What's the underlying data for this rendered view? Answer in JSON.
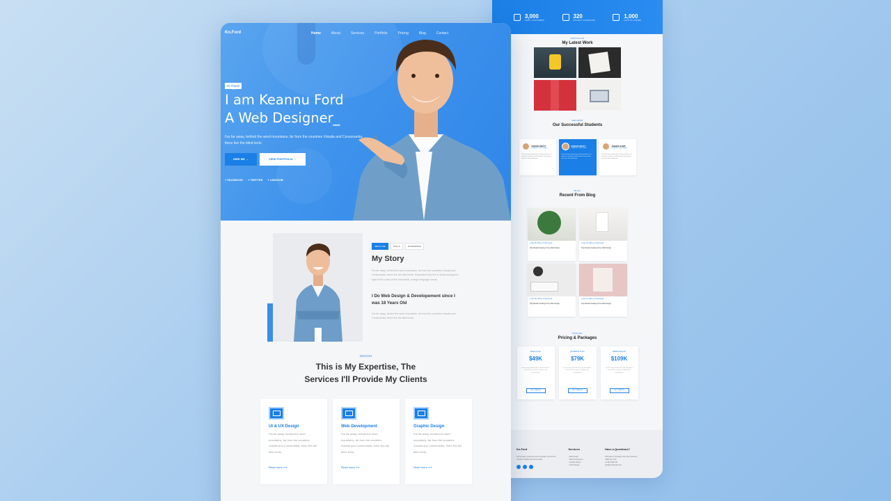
{
  "back_page": {
    "stats": [
      {
        "value": "3,000",
        "label": "HAPPY CUSTOMERS"
      },
      {
        "value": "320",
        "label": "PROJECT COMPLETED"
      },
      {
        "value": "1,000",
        "label": "CUPS OF COFFEE"
      }
    ],
    "work": {
      "kicker": "PORTFOLIO",
      "title": "My Latest Work"
    },
    "students": {
      "kicker": "REVIEWS",
      "title": "Our Successful Students",
      "items": [
        {
          "name": "ROGER WOTT",
          "role": "GRAPHIC DESIGNER",
          "text": "Far far away, behind the word mountains, far from the countries Vokalia and Consonantia, there live the blind texts."
        },
        {
          "name": "ROGER WOTT",
          "role": "GRAPHIC DESIGNER",
          "text": "Far far away, behind the word mountains, far from the countries Vokalia and Consonantia, there live the blind texts."
        },
        {
          "name": "ANGER KAMT",
          "role": "GRAPHIC DESIGNER",
          "text": "Far far away, behind the word mountains, far from the countries Vokalia and Consonantia, there live the blind texts."
        }
      ]
    },
    "blog": {
      "kicker": "BLOG",
      "title": "Recent From Blog",
      "items": [
        {
          "meta": "● Jan 10, 2021   ● 3 Comments",
          "title": "Tips Rental Creating A Free Web Design"
        },
        {
          "meta": "● Jan 10, 2021   ● 3 Comments",
          "title": "Tips Rental Creating A Free Web Design"
        },
        {
          "meta": "● Jan 10, 2021   ● 3 Comments",
          "title": "Tips Rental Creating A Free Web Design"
        },
        {
          "meta": "● Jan 10, 2021   ● 3 Comments",
          "title": "Tips Rental Creating A Free Web Design"
        }
      ]
    },
    "pricing": {
      "kicker": "PRICING",
      "title": "Pricing & Packages",
      "plans": [
        {
          "name": "BASIC PLAN",
          "price": "$49K",
          "text": "Far far away, behind the word mountains, far from the countries Vokalia and Consonantia",
          "button": "GET STARTED"
        },
        {
          "name": "BUSINESS PLAN",
          "price": "$79K",
          "text": "Far far away, behind the word mountains, far from the countries Vokalia and Consonantia",
          "button": "GET STARTED"
        },
        {
          "name": "PREMIUM PLAN",
          "price": "$109K",
          "text": "Far far away, behind the word mountains, far from the countries Vokalia and Consonantia",
          "button": "GET STARTED"
        }
      ]
    },
    "footer": {
      "brand": "Kn.Ford",
      "about": "Far far away, behind the word mountains, far from the countries Vokalia and Consonantia.",
      "services_title": "Services",
      "services": [
        "› Web Design",
        "› Web Development",
        "› Graphic Design",
        "› UI/UX Design"
      ],
      "contact_title": "Have a Questions?",
      "contact": [
        "203 Fake St. Mountain View, San Francisco, California, USA",
        "+2 392 3929 210",
        "info@yourdomain.com"
      ]
    }
  },
  "front_page": {
    "logo": "Kn.Ford",
    "nav": [
      "Home",
      "About",
      "Services",
      "Portfolio",
      "Pricing",
      "Blog",
      "Contact"
    ],
    "hero": {
      "greeting": "Hi There!",
      "line1": "I am Keannu Ford",
      "line2": "A Web Designer_",
      "intro": "Far far away, behind the word mountains, far from the countries Vokalia and Consonantia, there live the blind texts.",
      "hire": "HIRE ME  →",
      "portfolio": "VIEW PORTFOLIO  →",
      "social": [
        "+ FACEBOOK",
        "+ TWITTER",
        "+ LINKEDIN"
      ]
    },
    "about": {
      "tabs": [
        "ABOUT ME",
        "SKILLS",
        "EXPERIENCE"
      ],
      "title": "My Story",
      "p1": "Far far away, behind the word mountains, far from the countries Vokalia and Consonantia, there live the blind texts. Separated they live in Bookmarksgrove right at the coast of the Semantics, a large language ocean.",
      "since": "I Do Web Design & Developement since I was 18 Years Old",
      "p2": "Far far away, behind the word mountains, far from the countries Vokalia and Consonantia, there live the blind texts."
    },
    "services": {
      "kicker": "SERVICES",
      "title_l1": "This is My Expertise, The",
      "title_l2": "Services I'll Provide My Clients",
      "cards": [
        {
          "title": "UI & UX Design",
          "text": "Far far away, behind the word mountains, far from the countries Vokalia and Consonantia, there live the blind texts.",
          "link": "Read more ⟶"
        },
        {
          "title": "Web Development",
          "text": "Far far away, behind the word mountains, far from the countries Vokalia and Consonantia, there live the blind texts.",
          "link": "Read more ⟶"
        },
        {
          "title": "Graphic Design",
          "text": "Far far away, behind the word mountains, far from the countries Vokalia and Consonantia, there live the blind texts.",
          "link": "Read more ⟶"
        }
      ]
    }
  },
  "colors": {
    "accent": "#1a7fe6",
    "hero": "#3f93ec",
    "background": "#a9cdef"
  }
}
